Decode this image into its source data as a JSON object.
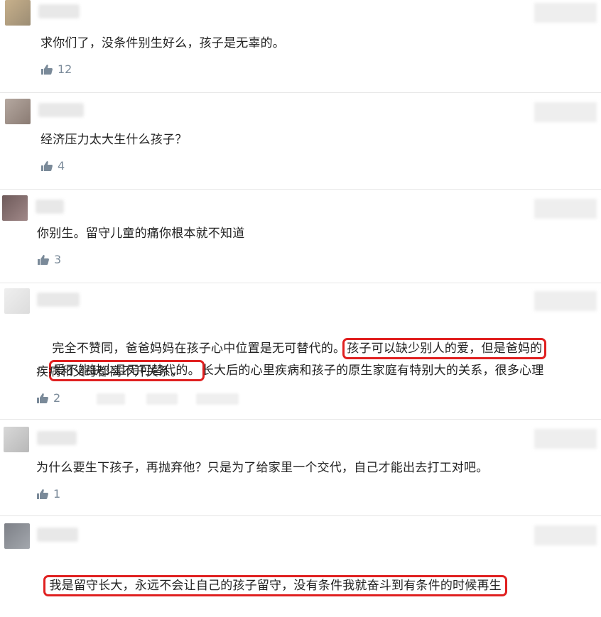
{
  "comments": [
    {
      "text": "求你们了，没条件别生好么，孩子是无辜的。",
      "likes": "12"
    },
    {
      "text": "经济压力太大生什么孩子？",
      "likes": "4"
    },
    {
      "text": "你别生。留守儿童的痛你根本就不知道",
      "likes": "3"
    },
    {
      "segments": [
        "完全不赞同，爸爸妈妈在孩子心中位置是无可替代的。",
        "孩子可以缺少别人的爱，但是爸妈的",
        "爱不能缺少且无可替代的。",
        "长大后的心里疾病和孩子的原生家庭有特别大的关系，很多心理",
        "疾病和父母都离不开关系。"
      ],
      "likes": "2"
    },
    {
      "text": "为什么要生下孩子，再抛弃他？只是为了给家里一个交代，自己才能出去打工对吧。",
      "likes": "1"
    },
    {
      "text": "我是留守长大，永远不会让自己的孩子留守，没有条件我就奋斗到有条件的时候再生"
    }
  ],
  "colors": {
    "highlight": "#e02020",
    "meta": "#7a8a99"
  },
  "icons": {
    "like": "thumbs-up-icon"
  }
}
